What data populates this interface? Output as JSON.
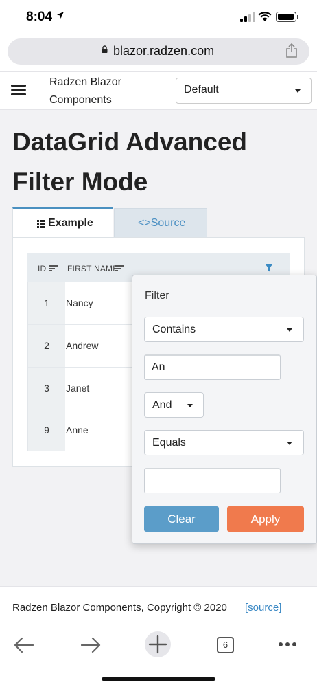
{
  "status_bar": {
    "time": "8:04"
  },
  "browser": {
    "url": "blazor.radzen.com"
  },
  "header": {
    "brand_line1": "Radzen Blazor",
    "brand_line2": "Components",
    "theme_selected": "Default"
  },
  "page": {
    "title_line1": "DataGrid Advanced",
    "title_line2": "Filter Mode"
  },
  "tabs": [
    {
      "label": "Example"
    },
    {
      "label": "<>Source"
    }
  ],
  "grid": {
    "columns": [
      "ID",
      "FIRST NAME"
    ],
    "rows": [
      {
        "id": "1",
        "first_name": "Nancy"
      },
      {
        "id": "2",
        "first_name": "Andrew"
      },
      {
        "id": "3",
        "first_name": "Janet"
      },
      {
        "id": "9",
        "first_name": "Anne"
      }
    ]
  },
  "filter": {
    "title": "Filter",
    "operator1": "Contains",
    "value1": "An",
    "logic": "And",
    "operator2": "Equals",
    "value2": "",
    "clear_label": "Clear",
    "apply_label": "Apply"
  },
  "footer": {
    "copyright": "Radzen Blazor Components, Copyright © 2020",
    "source_link": "[source]"
  },
  "toolbar": {
    "tab_count": "6"
  },
  "colors": {
    "accent_blue": "#5b9dc9",
    "apply_orange": "#f07a4d",
    "tab_active_border": "#4a90c0",
    "link": "#3a88c4"
  }
}
